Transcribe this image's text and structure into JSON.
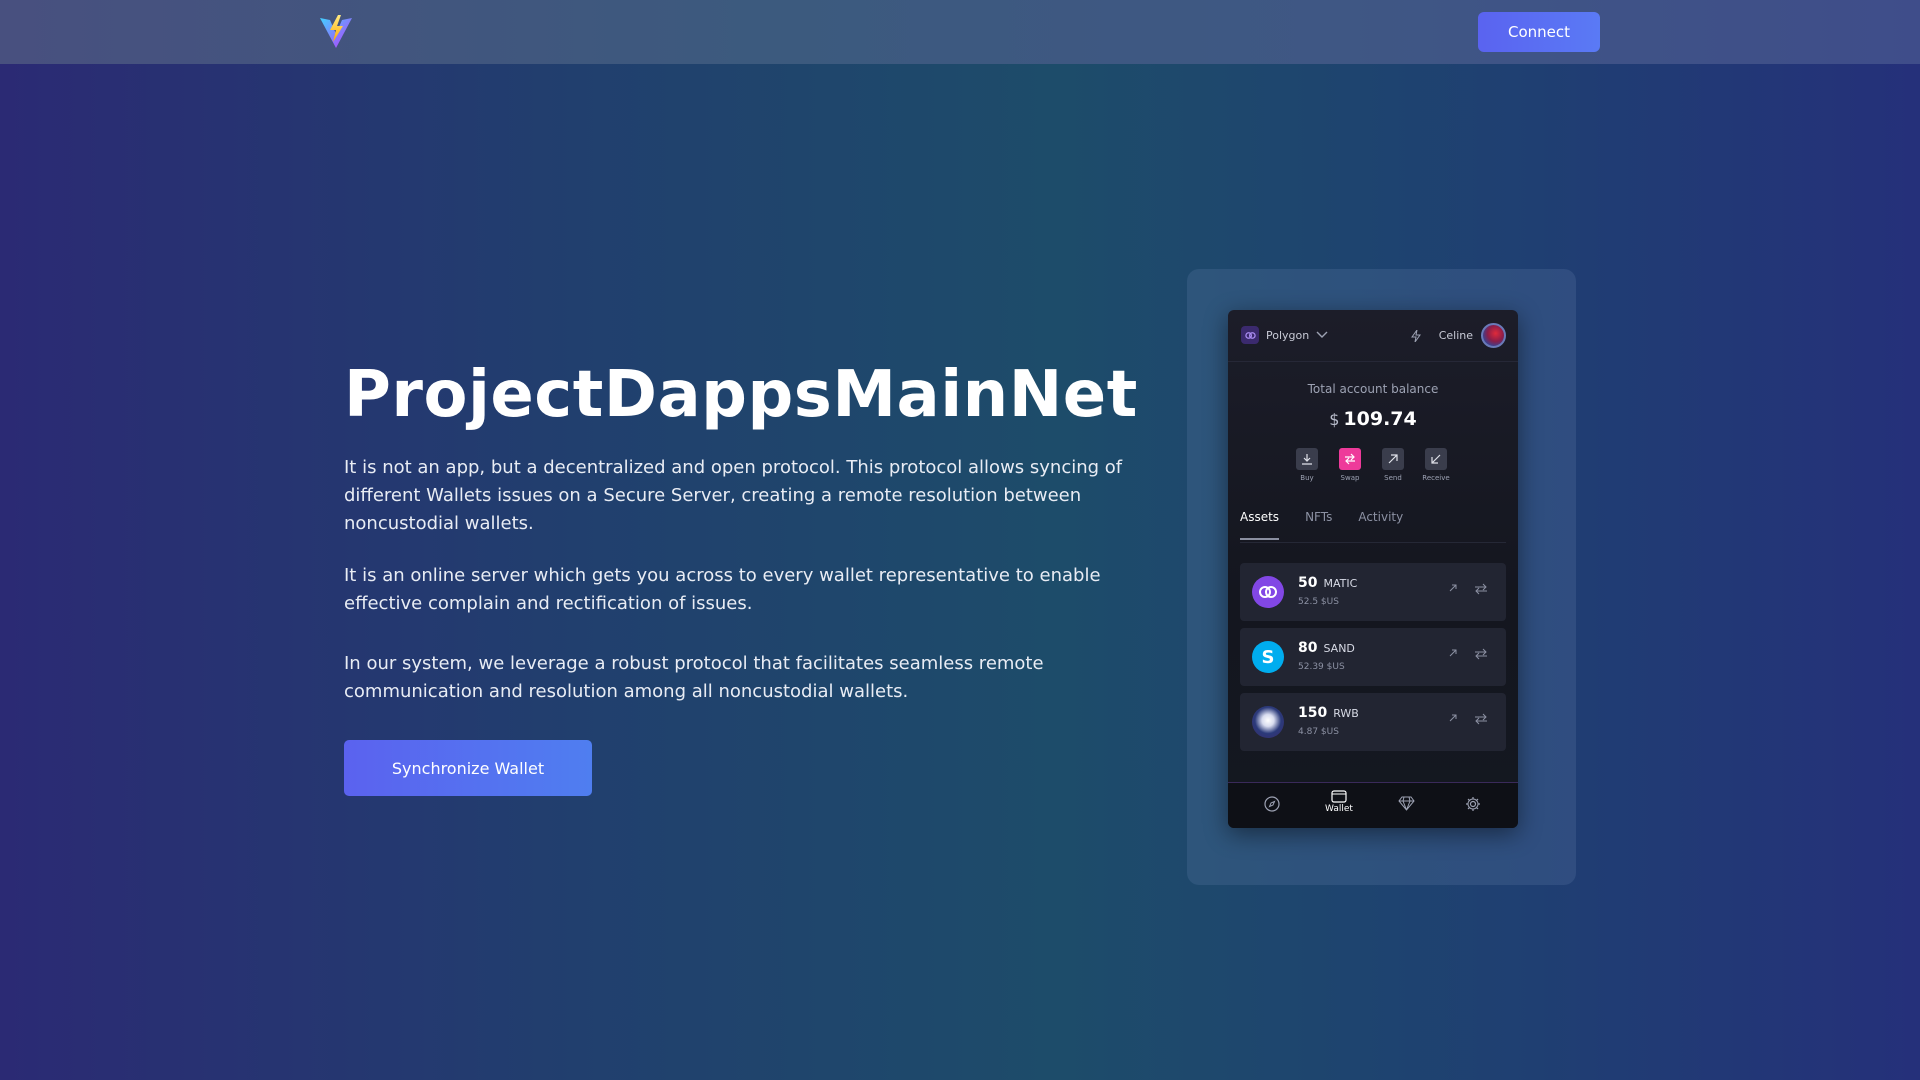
{
  "header": {
    "logo_icon": "lightning-v-logo",
    "connect_label": "Connect"
  },
  "hero": {
    "title": "ProjectDappsMainNet",
    "paragraphs": [
      "It is not an app, but a decentralized and open protocol. This protocol allows syncing of different Wallets issues on a Secure Server, creating a remote resolution between noncustodial wallets.",
      "It is an online server which gets you across to every wallet representative to enable effective complain and rectification of issues.",
      "In our system, we leverage a robust protocol that facilitates seamless remote communication and resolution among all noncustodial wallets."
    ],
    "cta_label": "Synchronize Wallet"
  },
  "wallet": {
    "network": "Polygon",
    "user_name": "Celine",
    "balance_label": "Total account balance",
    "currency_symbol": "$",
    "balance": "109.74",
    "actions": [
      {
        "label": "Buy",
        "icon": "download-icon"
      },
      {
        "label": "Swap",
        "icon": "swap-icon"
      },
      {
        "label": "Send",
        "icon": "arrow-up-right-icon"
      },
      {
        "label": "Receive",
        "icon": "arrow-down-left-icon"
      }
    ],
    "tabs": [
      "Assets",
      "NFTs",
      "Activity"
    ],
    "active_tab": "Assets",
    "assets": [
      {
        "amount": "50",
        "symbol": "MATIC",
        "usd": "52.5 $US",
        "color": "#8247e5"
      },
      {
        "amount": "80",
        "symbol": "SAND",
        "usd": "52.39 $US",
        "color": "#00adef"
      },
      {
        "amount": "150",
        "symbol": "RWB",
        "usd": "4.87 $US",
        "color": "#2b3a7a"
      }
    ],
    "bottom_nav": [
      {
        "icon": "compass-icon",
        "label": ""
      },
      {
        "icon": "wallet-icon",
        "label": "Wallet"
      },
      {
        "icon": "diamond-icon",
        "label": ""
      },
      {
        "icon": "gear-icon",
        "label": ""
      }
    ]
  },
  "colors": {
    "accent": "#5b62ef",
    "swap_accent": "#ee3a9a"
  }
}
